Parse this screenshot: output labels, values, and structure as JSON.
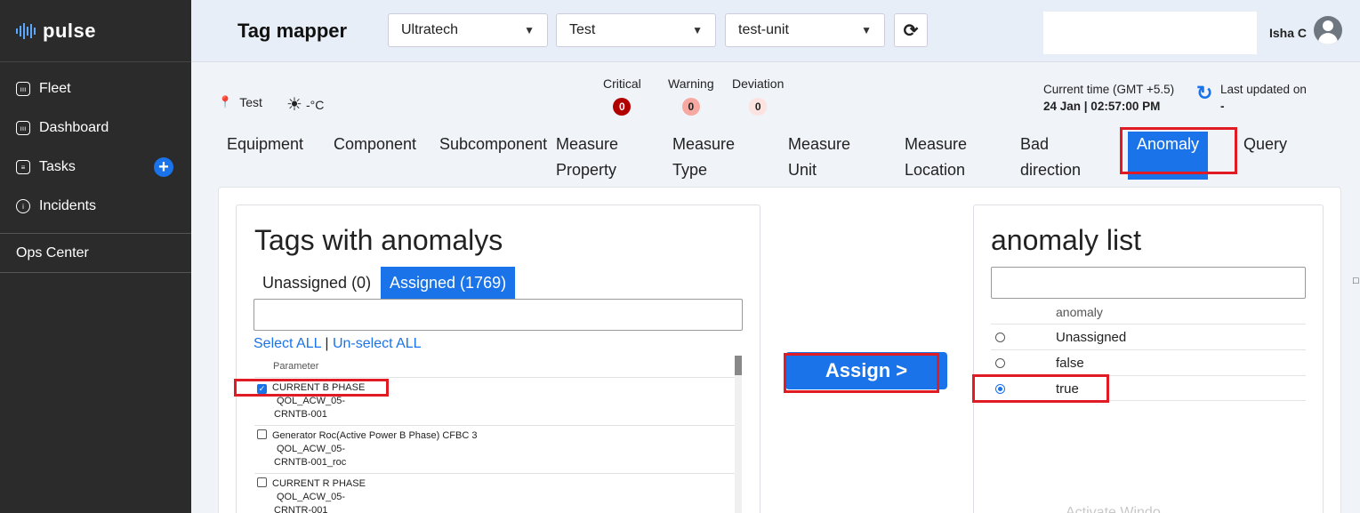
{
  "app": {
    "name": "pulse"
  },
  "sidebar": {
    "items": [
      {
        "label": "Fleet",
        "icon": "fleet-icon"
      },
      {
        "label": "Dashboard",
        "icon": "dashboard-icon"
      },
      {
        "label": "Tasks",
        "icon": "tasks-icon"
      },
      {
        "label": "Incidents",
        "icon": "info-icon"
      }
    ],
    "ops_center": "Ops Center"
  },
  "header": {
    "title": "Tag mapper",
    "selects": [
      "Ultratech",
      "Test",
      "test-unit"
    ],
    "user": "Isha C"
  },
  "status": {
    "location": "Test",
    "temperature": "-°C",
    "alerts": [
      {
        "label": "Critical",
        "count": "0"
      },
      {
        "label": "Warning",
        "count": "0"
      },
      {
        "label": "Deviation",
        "count": "0"
      }
    ],
    "current_time_label": "Current time (GMT +5.5)",
    "current_time_value": "24 Jan | 02:57:00 PM",
    "last_updated_label": "Last updated on",
    "last_updated_value": "-"
  },
  "tabs": [
    {
      "line1": "Equipment",
      "line2": ""
    },
    {
      "line1": "Component",
      "line2": ""
    },
    {
      "line1": "Subcomponent",
      "line2": ""
    },
    {
      "line1": "Measure",
      "line2": "Property"
    },
    {
      "line1": "Measure",
      "line2": "Type"
    },
    {
      "line1": "Measure",
      "line2": "Unit"
    },
    {
      "line1": "Measure",
      "line2": "Location"
    },
    {
      "line1": "Bad",
      "line2": "direction"
    },
    {
      "line1": "Anomaly",
      "line2": ""
    },
    {
      "line1": "Query",
      "line2": ""
    }
  ],
  "active_tab": "Anomaly",
  "left_panel": {
    "title": "Tags with anomalys",
    "tab_unassigned": "Unassigned (0)",
    "tab_assigned": "Assigned (1769)",
    "search_value": "",
    "select_all": "Select ALL",
    "separator": "|",
    "unselect_all": "Un-select ALL",
    "column_header": "Parameter",
    "rows": [
      {
        "name": "CURRENT B PHASE",
        "tag1": "QOL_ACW_05-",
        "tag2": "CRNTB-001",
        "checked": true
      },
      {
        "name": "Generator Roc(Active Power B Phase) CFBC 3",
        "tag1": "QOL_ACW_05-",
        "tag2": "CRNTB-001_roc",
        "checked": false
      },
      {
        "name": "CURRENT R PHASE",
        "tag1": "QOL_ACW_05-",
        "tag2": "CRNTR-001",
        "checked": false
      }
    ]
  },
  "assign_button": "Assign >",
  "right_panel": {
    "title": "anomaly list",
    "search_value": "",
    "column_header": "anomaly",
    "options": [
      {
        "label": "Unassigned",
        "selected": false
      },
      {
        "label": "false",
        "selected": false
      },
      {
        "label": "true",
        "selected": true
      }
    ]
  },
  "watermark": "Activate Windo",
  "edge_glyph": "□"
}
